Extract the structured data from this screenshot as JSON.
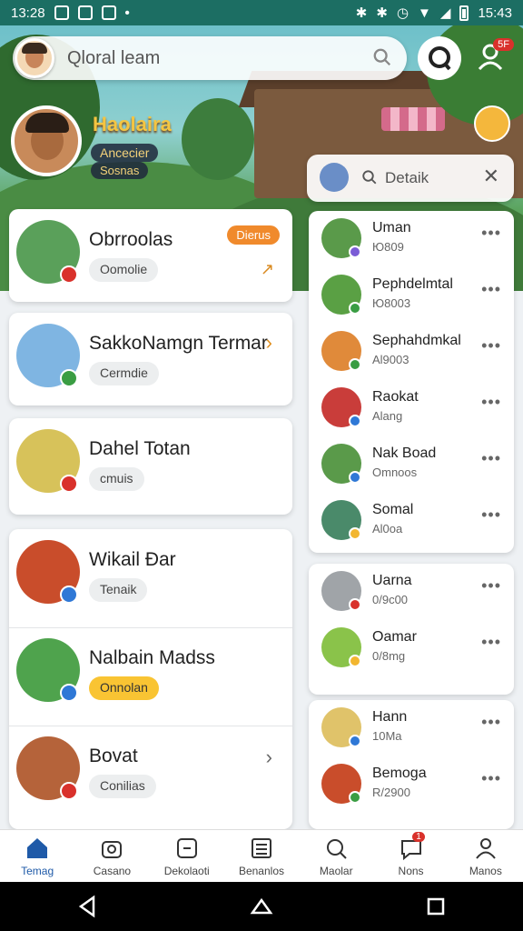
{
  "status_bar": {
    "time_left": "13:28",
    "time_right": "15:43"
  },
  "search": {
    "placeholder": "Qloral leam"
  },
  "notifications": {
    "badge": "5F"
  },
  "hero": {
    "name": "Haolaira",
    "subtitle": "Ancecier",
    "subtitle2": "Sosnas"
  },
  "left_list": [
    {
      "name": "Obrroolas",
      "chip": "Oomolie",
      "tag": "Dierus",
      "chip_style": "gray",
      "avatar_color": "#5aa05a",
      "badge_color": "#d9312b"
    },
    {
      "name": "SakkoNamgn Termar",
      "chip": "Cermdie",
      "chip_style": "gray",
      "avatar_color": "#7fb5e2",
      "badge_color": "#3a9d43"
    },
    {
      "name": "Dahel Totan",
      "chip": "cmuis",
      "chip_style": "gray",
      "avatar_color": "#d7c25a",
      "badge_color": "#d9312b"
    },
    {
      "name": "Wikail Ðar",
      "chip": "Tenaik",
      "chip_style": "gray",
      "avatar_color": "#c94d2b",
      "badge_color": "#2f78d6"
    },
    {
      "name": "Nalbain Madss",
      "chip": "Onnolan",
      "chip_style": "yellow",
      "avatar_color": "#4fa34d",
      "badge_color": "#2f78d6"
    },
    {
      "name": "Bovat",
      "chip": "Conilias",
      "chip_style": "gray",
      "avatar_color": "#b5633a",
      "badge_color": "#d9312b"
    }
  ],
  "right_search": {
    "text": "Detaik"
  },
  "right_list_1": [
    {
      "name": "Uman",
      "sub": "Ю809",
      "avatar_color": "#5a9a4a",
      "badge_color": "#7b5cd6"
    },
    {
      "name": "Pephdelmtal",
      "sub": "Ю8003",
      "avatar_color": "#5aa044",
      "badge_color": "#3a9d43"
    },
    {
      "name": "Sephahdmkal",
      "sub": "Al9003",
      "avatar_color": "#e08a3a",
      "badge_color": "#3a9d43"
    },
    {
      "name": "Raokat",
      "sub": "Alang",
      "avatar_color": "#c93d3a",
      "badge_color": "#2f78d6"
    },
    {
      "name": "Nak Boad",
      "sub": "Omnoos",
      "avatar_color": "#5a9a4a",
      "badge_color": "#2f78d6"
    },
    {
      "name": "Somal",
      "sub": "Al0oa",
      "avatar_color": "#4a8a6a",
      "badge_color": "#f2b630"
    }
  ],
  "right_list_2": [
    {
      "name": "Uarna",
      "sub": "0/9c00",
      "avatar_color": "#a0a4a8",
      "badge_color": "#d9312b"
    },
    {
      "name": "Oamar",
      "sub": "0/8mg",
      "avatar_color": "#8ac34a",
      "badge_color": "#f2b630"
    }
  ],
  "right_list_3": [
    {
      "name": "Hann",
      "sub": "10Ma",
      "avatar_color": "#e0c36a",
      "badge_color": "#2f78d6"
    },
    {
      "name": "Bemoga",
      "sub": "R/2900",
      "avatar_color": "#c94d2b",
      "badge_color": "#3a9d43"
    }
  ],
  "bottom_nav": [
    {
      "label": "Temag",
      "active": true
    },
    {
      "label": "Casano"
    },
    {
      "label": "Dekolaoti"
    },
    {
      "label": "Benanlos"
    },
    {
      "label": "Maolar"
    },
    {
      "label": "Nons",
      "badge": "1"
    },
    {
      "label": "Manos"
    }
  ]
}
